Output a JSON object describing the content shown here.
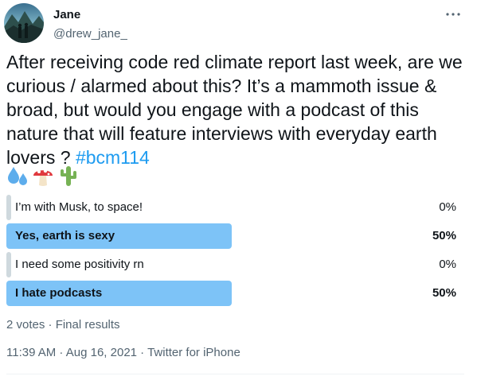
{
  "author": {
    "display_name": "Jane",
    "handle": "@drew_jane_"
  },
  "tweet": {
    "text": "After receiving code red climate report last week, are we curious / alarmed about this? It’s a mammoth issue & broad, but would you engage with a podcast of this nature that will feature interviews with everyday earth lovers ? ",
    "hashtag": "#bcm114",
    "emojis": [
      "sweat-droplets-icon",
      "mushroom-icon",
      "cactus-icon"
    ]
  },
  "poll": {
    "options": [
      {
        "label": "I’m with Musk, to space!",
        "percent": "0%",
        "fraction": 0.0,
        "winner": false
      },
      {
        "label": "Yes, earth is sexy",
        "percent": "50%",
        "fraction": 0.5,
        "winner": true
      },
      {
        "label": "I need some positivity rn",
        "percent": "0%",
        "fraction": 0.0,
        "winner": false
      },
      {
        "label": "I hate podcasts",
        "percent": "50%",
        "fraction": 0.5,
        "winner": true
      }
    ],
    "votes_summary": "2 votes · Final results"
  },
  "meta": {
    "timestamp": "11:39 AM · Aug 16, 2021 · Twitter for iPhone"
  },
  "colors": {
    "accent": "#1d9bf0",
    "winner_bar": "#7dc3f7",
    "loser_bar": "#cfd9de",
    "secondary_text": "#536471"
  }
}
